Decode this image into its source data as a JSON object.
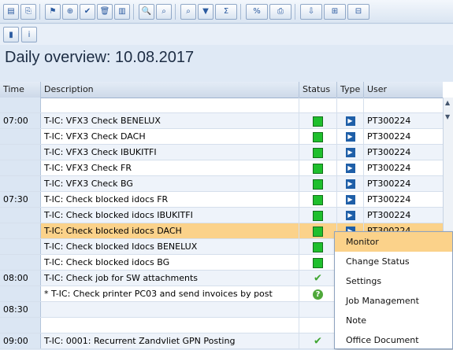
{
  "toolbar": {
    "buttons": [
      {
        "name": "save-icon",
        "glyph": "▤"
      },
      {
        "name": "new-entry-icon",
        "glyph": "⎘"
      },
      {
        "name": "flag-icon",
        "glyph": "⚑"
      },
      {
        "name": "forward-icon",
        "glyph": "⊕"
      },
      {
        "name": "approve-icon",
        "glyph": "✔"
      },
      {
        "name": "delete-icon",
        "glyph": "🗑"
      },
      {
        "name": "layout-icon",
        "glyph": "▥"
      },
      {
        "name": "search-icon",
        "glyph": "🔍"
      },
      {
        "name": "find-icon",
        "glyph": "⌕"
      },
      {
        "name": "find-next-icon",
        "glyph": "⌕"
      },
      {
        "name": "filter-icon",
        "glyph": "▼"
      },
      {
        "name": "sum-icon",
        "glyph": "Σ"
      },
      {
        "name": "subtotal-icon",
        "glyph": "%"
      },
      {
        "name": "print-icon",
        "glyph": "⎙"
      },
      {
        "name": "export-icon",
        "glyph": "⇩"
      },
      {
        "name": "view-icon",
        "glyph": "⊞"
      },
      {
        "name": "grid-icon",
        "glyph": "⊟"
      }
    ],
    "secondary": [
      {
        "name": "chart-icon",
        "glyph": "▮"
      },
      {
        "name": "info-icon",
        "glyph": "i"
      }
    ]
  },
  "page_title": "Daily overview: 10.08.2017",
  "table": {
    "headers": {
      "time": "Time",
      "description": "Description",
      "status": "Status",
      "type": "Type",
      "user": "User"
    },
    "rows": [
      {
        "time": "",
        "description": "",
        "status": "",
        "type": "",
        "user": ""
      },
      {
        "time": "07:00",
        "description": "T-IC: VFX3 Check BENELUX",
        "status": "green",
        "type": "job",
        "user": "PT300224"
      },
      {
        "time": "",
        "description": "T-IC: VFX3 Check DACH",
        "status": "green",
        "type": "job",
        "user": "PT300224"
      },
      {
        "time": "",
        "description": "T-IC: VFX3 Check IBUKITFI",
        "status": "green",
        "type": "job",
        "user": "PT300224"
      },
      {
        "time": "",
        "description": "T-IC: VFX3 Check FR",
        "status": "green",
        "type": "job",
        "user": "PT300224"
      },
      {
        "time": "",
        "description": "T-IC: VFX3 Check BG",
        "status": "green",
        "type": "job",
        "user": "PT300224"
      },
      {
        "time": "07:30",
        "description": "T-IC: Check blocked idocs FR",
        "status": "green",
        "type": "job",
        "user": "PT300224"
      },
      {
        "time": "",
        "description": "T-IC: Check blocked idocs IBUKITFI",
        "status": "green",
        "type": "job",
        "user": "PT300224"
      },
      {
        "time": "",
        "description": "T-IC: Check blocked idocs DACH",
        "status": "green",
        "type": "job",
        "user": "PT300224"
      },
      {
        "time": "",
        "description": "T-IC: Check blocked Idocs BENELUX",
        "status": "green",
        "type": "",
        "user": ""
      },
      {
        "time": "",
        "description": "T-IC: Check blocked idocs  BG",
        "status": "green",
        "type": "",
        "user": ""
      },
      {
        "time": "08:00",
        "description": "T-IC: Check job for SW attachments",
        "status": "check",
        "type": "",
        "user": ""
      },
      {
        "time": "",
        "description": "* T-IC: Check printer PC03 and send invoices by post",
        "status": "question",
        "type": "",
        "user": ""
      },
      {
        "time": "08:30",
        "description": "",
        "status": "",
        "type": "",
        "user": ""
      },
      {
        "time": "",
        "description": "",
        "status": "",
        "type": "",
        "user": ""
      },
      {
        "time": "09:00",
        "description": "T-IC: 0001: Recurrent Zandvliet GPN Posting",
        "status": "check",
        "type": "",
        "user": ""
      }
    ]
  },
  "context_menu": {
    "items": [
      "Monitor",
      "Change Status",
      "Settings",
      "Job Management",
      "Note",
      "Office Document"
    ]
  }
}
